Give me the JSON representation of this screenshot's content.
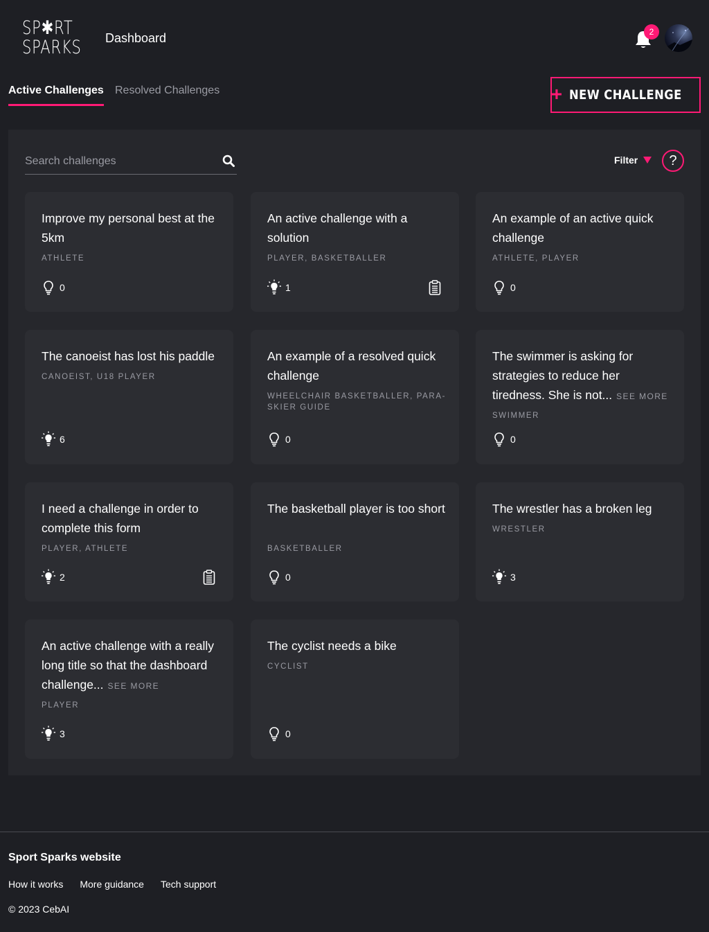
{
  "header": {
    "logo_line1": "SP✱RT",
    "logo_line2": "SPARKS",
    "title": "Dashboard",
    "notification_count": "2"
  },
  "tabs": [
    {
      "label": "Active Challenges",
      "active": true
    },
    {
      "label": "Resolved Challenges",
      "active": false
    }
  ],
  "new_button": {
    "plus": "+",
    "label": "NEW CHALLENGE"
  },
  "search": {
    "placeholder": "Search challenges"
  },
  "filter": {
    "label": "Filter"
  },
  "help": {
    "label": "?"
  },
  "colors": {
    "accent": "#ff1a75",
    "background": "#1e1f24",
    "panel": "#26272c",
    "card": "#2c2d32"
  },
  "cards": [
    {
      "title": "Improve my personal best at the 5km",
      "see_more": "",
      "tags": "ATHLETE",
      "ideas": "0",
      "bulb": "outline",
      "has_solution": false
    },
    {
      "title": "An active challenge with a solution",
      "see_more": "",
      "tags": "PLAYER, BASKETBALLER",
      "ideas": "1",
      "bulb": "lit",
      "has_solution": true
    },
    {
      "title": "An example of an active quick challenge",
      "see_more": "",
      "tags": "ATHLETE, PLAYER",
      "ideas": "0",
      "bulb": "outline",
      "has_solution": false
    },
    {
      "title": "The canoeist has lost his paddle",
      "see_more": "",
      "tags": "CANOEIST, U18 PLAYER",
      "ideas": "6",
      "bulb": "lit",
      "has_solution": false
    },
    {
      "title": "An example of a resolved quick challenge",
      "see_more": "",
      "tags": "WHEELCHAIR BASKETBALLER, PARA-SKIER GUIDE",
      "ideas": "0",
      "bulb": "outline",
      "has_solution": false
    },
    {
      "title": "The swimmer is asking for strategies to reduce her tiredness. She is not...",
      "see_more": "SEE MORE",
      "tags": "SWIMMER",
      "ideas": "0",
      "bulb": "outline",
      "has_solution": false
    },
    {
      "title": "I need a challenge in order to complete this form",
      "see_more": "",
      "tags": "PLAYER, ATHLETE",
      "ideas": "2",
      "bulb": "lit",
      "has_solution": true
    },
    {
      "title": "The basketball player is too short",
      "see_more": "",
      "tags": "BASKETBALLER",
      "ideas": "0",
      "bulb": "outline",
      "has_solution": false
    },
    {
      "title": "The wrestler has a broken leg",
      "see_more": "",
      "tags": "WRESTLER",
      "ideas": "3",
      "bulb": "lit",
      "has_solution": false
    },
    {
      "title": "An active challenge with a really long title so that the dashboard challenge...",
      "see_more": "SEE MORE",
      "tags": "PLAYER",
      "ideas": "3",
      "bulb": "lit",
      "has_solution": false
    },
    {
      "title": "The cyclist needs a bike",
      "see_more": "",
      "tags": "CYCLIST",
      "ideas": "0",
      "bulb": "outline",
      "has_solution": false
    }
  ],
  "footer": {
    "title": "Sport Sparks website",
    "links": [
      "How it works",
      "More guidance",
      "Tech support"
    ],
    "copyright": "© 2023 CebAI"
  }
}
